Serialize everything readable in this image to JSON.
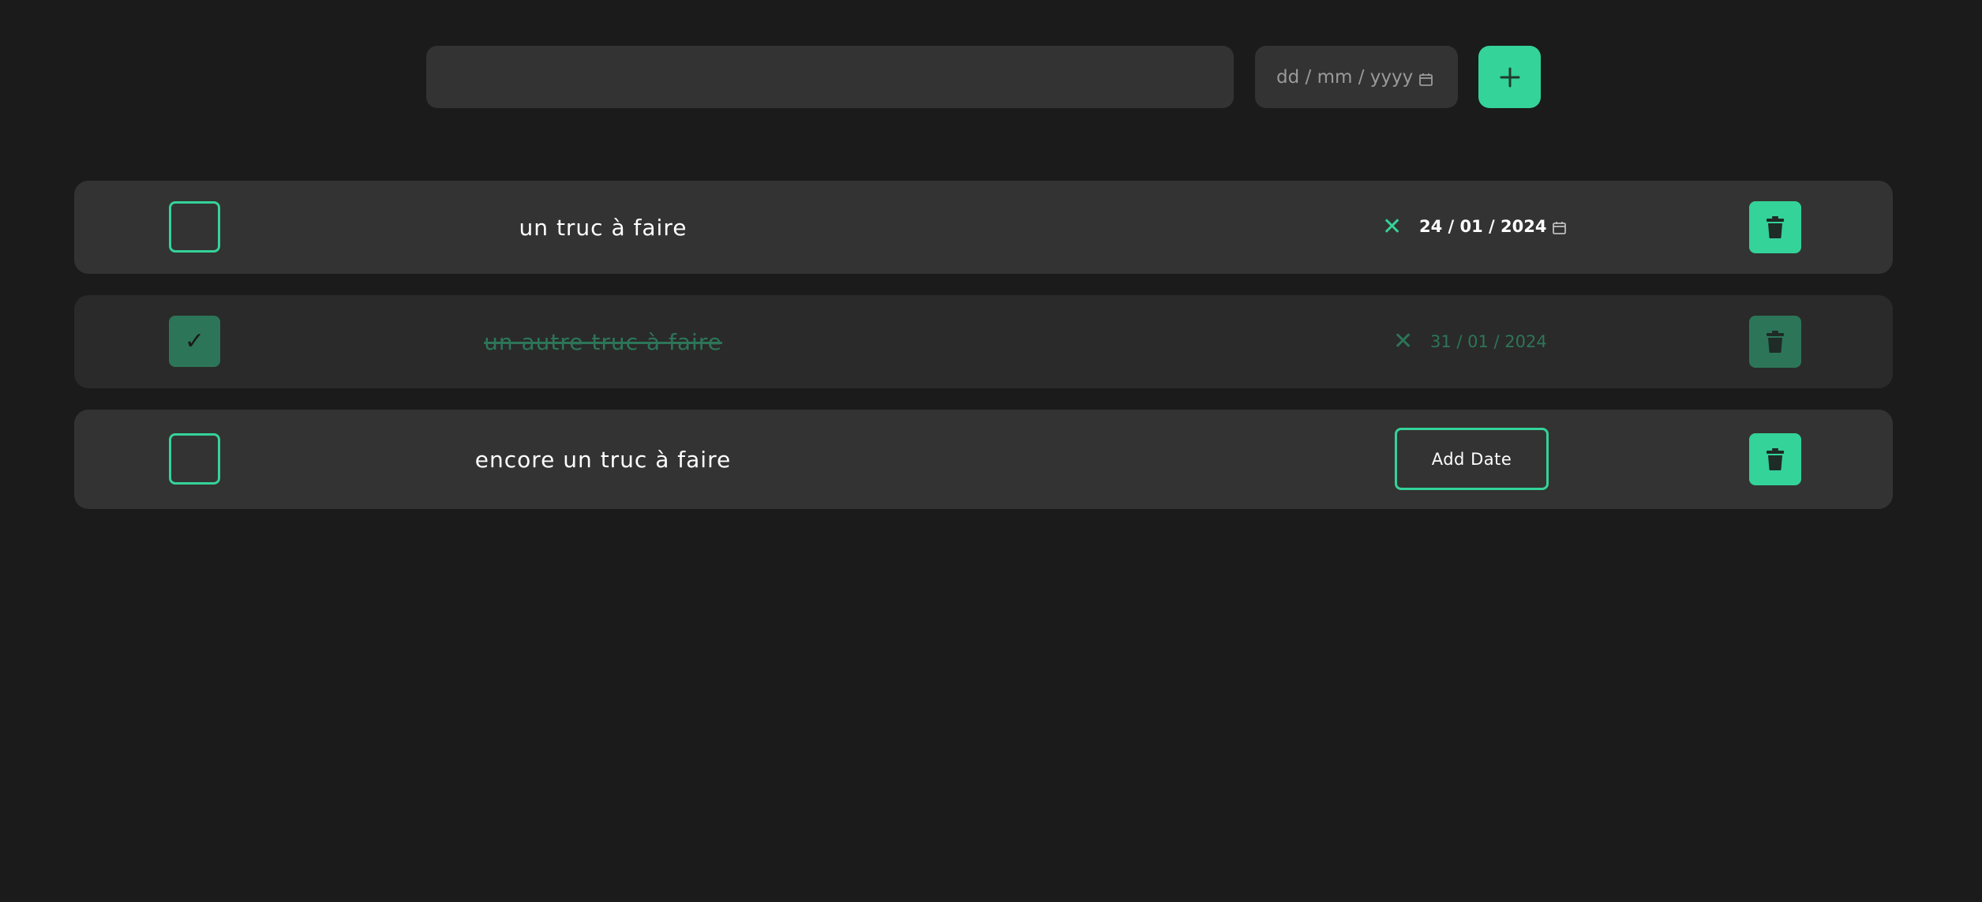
{
  "form": {
    "text_value": "",
    "date_placeholder": "dd / mm / yyyy",
    "add_label": "+"
  },
  "todos": [
    {
      "text": "un truc à faire",
      "done": false,
      "date": "24 / 01 / 2024",
      "clear_label": "✕"
    },
    {
      "text": "un autre truc à faire",
      "done": true,
      "date": "31 / 01 / 2024",
      "clear_label": "✕",
      "check_mark": "✓"
    },
    {
      "text": "encore un truc à faire",
      "done": false,
      "add_date_label": "Add Date"
    }
  ],
  "colors": {
    "background": "#1b1b1b",
    "card": "#333333",
    "card_done": "#2a2a2a",
    "accent": "#34d399",
    "accent_dim": "#2d7559",
    "text": "#ffffff",
    "placeholder": "#9a9a9a"
  },
  "icons": {
    "add": "plus-icon",
    "clear": "close-icon",
    "delete": "trash-icon",
    "calendar": "calendar-icon",
    "check": "check-icon"
  }
}
